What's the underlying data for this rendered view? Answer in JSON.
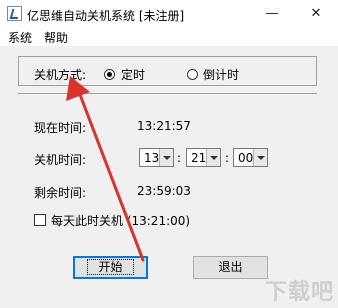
{
  "window": {
    "title": "亿思维自动关机系统 [未注册]",
    "minimize_glyph": "—",
    "close_glyph": "✕"
  },
  "menu": {
    "items": [
      "系统",
      "帮助"
    ]
  },
  "shutdown_mode": {
    "label": "关机方式:",
    "options": [
      {
        "label": "定时",
        "selected": true
      },
      {
        "label": "倒计时",
        "selected": false
      }
    ]
  },
  "current_time": {
    "label": "现在时间:",
    "value": "13:21:57"
  },
  "shutdown_time": {
    "label": "关机时间:",
    "hour": "13",
    "minute": "21",
    "second": "00",
    "separator": ":"
  },
  "remaining_time": {
    "label": "剩余时间:",
    "value": "23:59:03"
  },
  "daily": {
    "label": "每天此时关机 (13:21:00)",
    "checked": false
  },
  "buttons": {
    "start": "开始",
    "exit": "退出"
  },
  "watermark": "下载吧",
  "colors": {
    "annotation_arrow": "#d9342b",
    "focus_border": "#0078d7"
  }
}
